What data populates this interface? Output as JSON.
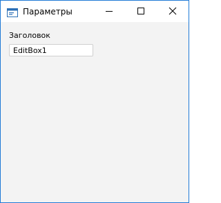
{
  "window": {
    "title": "Параметры",
    "icon": "window-app-icon",
    "controls": {
      "minimize_icon": "minimize-icon",
      "maximize_icon": "maximize-icon",
      "close_icon": "close-icon"
    },
    "border_color": "#1e79d6"
  },
  "form": {
    "label": "Заголовок",
    "edit_value": "EditBox1"
  }
}
